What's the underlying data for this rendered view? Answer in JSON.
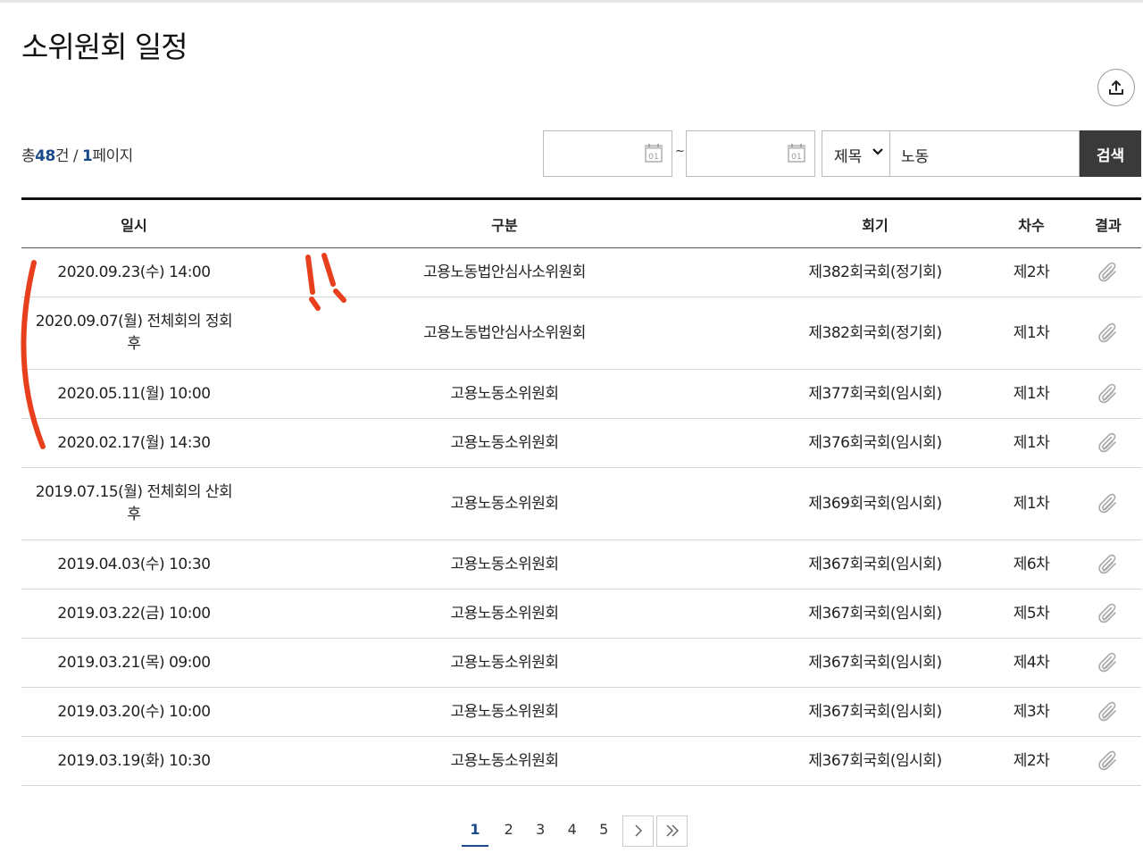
{
  "page": {
    "title": "소위원회 일정",
    "summary": {
      "prefix": "총",
      "total": "48",
      "unit": "건 / ",
      "page": "1",
      "page_suffix": "페이지"
    }
  },
  "search": {
    "date_from": "",
    "date_to": "",
    "tilde": "~",
    "field_selected": "제목",
    "query": "노동",
    "button_label": "검색"
  },
  "table": {
    "headers": [
      "일시",
      "구분",
      "회기",
      "차수",
      "결과"
    ],
    "rows": [
      {
        "date": "2020.09.23(수) 14:00",
        "type": "고용노동법안심사소위원회",
        "session": "제382회국회(정기회)",
        "order": "제2차"
      },
      {
        "date": "2020.09.07(월) 전체회의 정회 후",
        "type": "고용노동법안심사소위원회",
        "session": "제382회국회(정기회)",
        "order": "제1차"
      },
      {
        "date": "2020.05.11(월) 10:00",
        "type": "고용노동소위원회",
        "session": "제377회국회(임시회)",
        "order": "제1차"
      },
      {
        "date": "2020.02.17(월) 14:30",
        "type": "고용노동소위원회",
        "session": "제376회국회(임시회)",
        "order": "제1차"
      },
      {
        "date": "2019.07.15(월) 전체회의 산회 후",
        "type": "고용노동소위원회",
        "session": "제369회국회(임시회)",
        "order": "제1차"
      },
      {
        "date": "2019.04.03(수) 10:30",
        "type": "고용노동소위원회",
        "session": "제367회국회(임시회)",
        "order": "제6차"
      },
      {
        "date": "2019.03.22(금) 10:00",
        "type": "고용노동소위원회",
        "session": "제367회국회(임시회)",
        "order": "제5차"
      },
      {
        "date": "2019.03.21(목) 09:00",
        "type": "고용노동소위원회",
        "session": "제367회국회(임시회)",
        "order": "제4차"
      },
      {
        "date": "2019.03.20(수) 10:00",
        "type": "고용노동소위원회",
        "session": "제367회국회(임시회)",
        "order": "제3차"
      },
      {
        "date": "2019.03.19(화) 10:30",
        "type": "고용노동소위원회",
        "session": "제367회국회(임시회)",
        "order": "제2차"
      }
    ]
  },
  "pagination": {
    "pages": [
      "1",
      "2",
      "3",
      "4",
      "5"
    ],
    "current": "1"
  },
  "icons": {
    "export": "share-export-icon",
    "calendar": "calendar-icon",
    "result": "paperclip-icon",
    "next": "chevron-right-icon",
    "last": "double-chevron-right-icon"
  },
  "colors": {
    "accent": "#1a4a8a",
    "search_button": "#3a3a3a",
    "annotation": "#e8401c"
  }
}
